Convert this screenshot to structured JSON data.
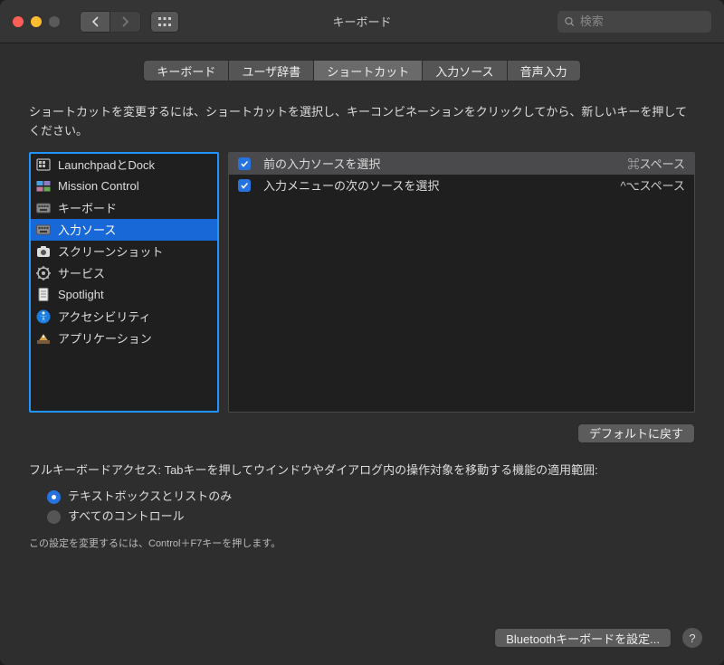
{
  "window": {
    "title": "キーボード"
  },
  "search": {
    "placeholder": "検索"
  },
  "tabs": [
    {
      "label": "キーボード",
      "active": false
    },
    {
      "label": "ユーザ辞書",
      "active": false
    },
    {
      "label": "ショートカット",
      "active": true
    },
    {
      "label": "入力ソース",
      "active": false
    },
    {
      "label": "音声入力",
      "active": false
    }
  ],
  "description": "ショートカットを変更するには、ショートカットを選択し、キーコンビネーションをクリックしてから、新しいキーを押してください。",
  "categories": [
    {
      "label": "LaunchpadとDock",
      "icon": "launchpad",
      "selected": false
    },
    {
      "label": "Mission Control",
      "icon": "mission-control",
      "selected": false
    },
    {
      "label": "キーボード",
      "icon": "keyboard",
      "selected": false
    },
    {
      "label": "入力ソース",
      "icon": "input-sources",
      "selected": true
    },
    {
      "label": "スクリーンショット",
      "icon": "screenshot",
      "selected": false
    },
    {
      "label": "サービス",
      "icon": "services",
      "selected": false
    },
    {
      "label": "Spotlight",
      "icon": "spotlight",
      "selected": false
    },
    {
      "label": "アクセシビリティ",
      "icon": "accessibility",
      "selected": false
    },
    {
      "label": "アプリケーション",
      "icon": "app",
      "selected": false
    }
  ],
  "shortcuts": [
    {
      "enabled": true,
      "label": "前の入力ソースを選択",
      "keys": "⌘スペース",
      "highlighted": true
    },
    {
      "enabled": true,
      "label": "入力メニューの次のソースを選択",
      "keys": "^⌥スペース",
      "highlighted": false
    }
  ],
  "buttons": {
    "restore_defaults": "デフォルトに戻す",
    "bluetooth": "Bluetoothキーボードを設定..."
  },
  "fka": {
    "heading": "フルキーボードアクセス: Tabキーを押してウインドウやダイアログ内の操作対象を移動する機能の適用範囲:",
    "options": [
      {
        "label": "テキストボックスとリストのみ",
        "selected": true
      },
      {
        "label": "すべてのコントロール",
        "selected": false
      }
    ],
    "hint": "この設定を変更するには、Control＋F7キーを押します。"
  }
}
